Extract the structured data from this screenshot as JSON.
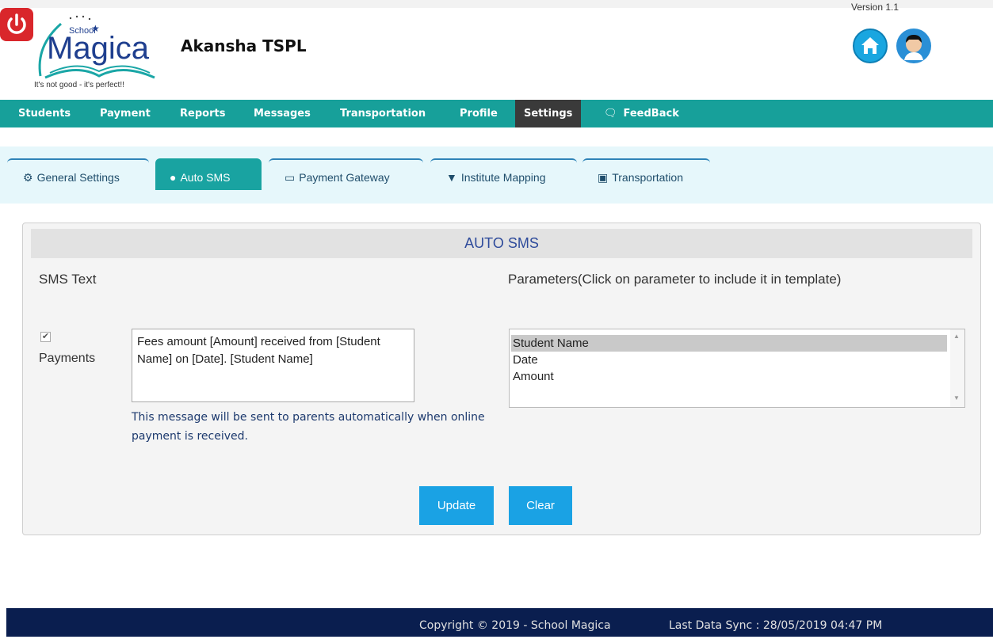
{
  "header": {
    "logo_small": "School",
    "logo_big": "Magica",
    "logo_tagline": "It's not good - it's perfect!!",
    "org_name": "Akansha TSPL",
    "version": "Version 1.1"
  },
  "nav": [
    "Students",
    "Payment",
    "Reports",
    "Messages",
    "Transportation",
    "Profile",
    "Settings",
    "FeedBack"
  ],
  "tabs": [
    "General Settings",
    "Auto SMS",
    "Payment Gateway",
    "Institute Mapping",
    "Transportation"
  ],
  "panel": {
    "title": "AUTO SMS",
    "sms_text_label": "SMS Text",
    "parameters_label": "Parameters(Click on parameter to include it in template)",
    "payments_label": "Payments",
    "payments_checked": true,
    "sms_template": "Fees amount  [Amount] received from [Student Name] on [Date]. [Student Name]",
    "help_text": "This message will be sent to parents automatically when online payment is received.",
    "parameters": [
      "Student Name",
      "Date",
      "Amount"
    ],
    "selected_parameter": "Student Name",
    "update_label": "Update",
    "clear_label": "Clear"
  },
  "footer": {
    "copyright": "Copyright © 2019 - School Magica",
    "last_sync": "Last Data Sync : 28/05/2019 04:47 PM"
  },
  "colors": {
    "nav_bg": "#17a09a",
    "active_tab": "#19a3a1",
    "button": "#1aa2e4",
    "footer_bg": "#0a1e4f"
  }
}
